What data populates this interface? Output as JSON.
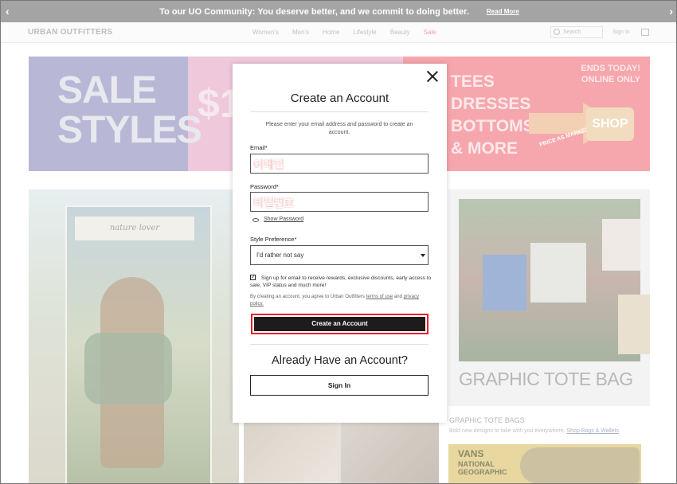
{
  "announcement": {
    "prev_icon": "chevron-left-icon",
    "message": "To our UO Community: You deserve better, and we commit to doing better.",
    "link": "Read More",
    "next_icon": "chevron-right-icon"
  },
  "header": {
    "logo": "URBAN OUTFITTERS",
    "nav": [
      "Women's",
      "Men's",
      "Home",
      "Lifestyle",
      "Beauty",
      "Sale"
    ],
    "search_placeholder": "Search",
    "sign_in": "Sign In",
    "bag_icon": "shopping-bag-icon"
  },
  "banner": {
    "sale_line1": "SALE",
    "sale_line2": "STYLES",
    "dollar": "$1",
    "items": [
      "TEES",
      "DRESSES",
      "BOTTOMS",
      "& MORE"
    ],
    "ends_line1": "ENDS TODAY!",
    "ends_line2": "ONLINE ONLY",
    "price_as_marked": "PRICE AS MARKED",
    "shop": "SHOP"
  },
  "content": {
    "card_label": "nature lover",
    "graphic_text": "GRAPHIC TOTE BAG",
    "graphic_caption": "GRAPHIC TOTE BAGS",
    "graphic_sub": "Bold new designs to take with you everywhere.",
    "graphic_link": "Shop Bags & Wallets",
    "vans_logo": "VANS",
    "vans_line1": "NATIONAL",
    "vans_line2": "GEOGRAPHIC"
  },
  "modal": {
    "close_icon": "close-icon",
    "title": "Create an Account",
    "description": "Please enter your email address and password to create an account.",
    "email_label": "Email*",
    "email_value": "이메일",
    "password_label": "Password*",
    "password_value": "비밀번호",
    "show_password": "Show Password",
    "style_label": "Style Preference*",
    "style_value": "I'd rather not say",
    "signup_text": "Sign up for email to receive rewards, exclusive discounts, early access to sale, VIP status and much more!",
    "signup_checked": true,
    "terms_prefix": "By creating an account, you agree to Urban Outfitters",
    "terms_link": "terms of use",
    "terms_mid": "and",
    "privacy_link": "privacy policy.",
    "create_button": "Create an Account",
    "already_title": "Already Have an Account?",
    "signin_button": "Sign In"
  },
  "colors": {
    "highlight_border": "#e8202a",
    "primary_button": "#1c1c1c",
    "sale_nav": "#f0a3a3"
  }
}
